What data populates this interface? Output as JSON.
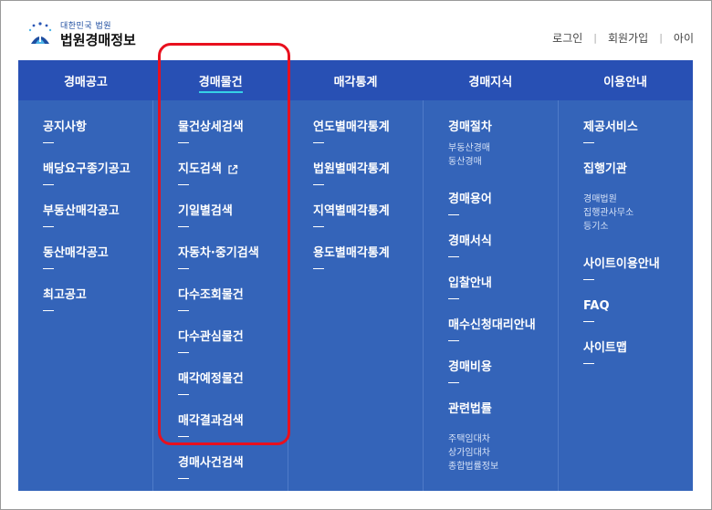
{
  "header": {
    "logo_small": "대한민국 법원",
    "logo_title": "법원경매정보",
    "util": [
      "로그인",
      "회원가입",
      "아이"
    ]
  },
  "nav": {
    "items": [
      "경매공고",
      "경매물건",
      "매각통계",
      "경매지식",
      "이용안내"
    ],
    "active_index": 1,
    "bg_color": "#2850b4",
    "active_underline_color": "#36d1e6"
  },
  "menu": {
    "col0": [
      "공지사항",
      "배당요구종기공고",
      "부동산매각공고",
      "동산매각공고",
      "최고공고"
    ],
    "col1": [
      "물건상세검색",
      "지도검색",
      "기일별검색",
      "자동차·중기검색",
      "다수조회물건",
      "다수관심물건",
      "매각예정물건",
      "매각결과검색",
      "경매사건검색"
    ],
    "col2": [
      "연도별매각통계",
      "법원별매각통계",
      "지역별매각통계",
      "용도별매각통계"
    ],
    "col3": {
      "procedure": "경매절차",
      "procedure_subs": [
        "부동산경매",
        "동산경매"
      ],
      "items": [
        "경매용어",
        "경매서식",
        "입찰안내",
        "매수신청대리안내",
        "경매비용",
        "관련법률"
      ],
      "law_subs": [
        "주택임대차",
        "상가임대차",
        "종합법률정보"
      ]
    },
    "col4": {
      "service": "제공서비스",
      "agency": "집행기관",
      "agency_subs": [
        "경매법원",
        "집행관사무소",
        "등기소"
      ],
      "items": [
        "사이트이용안내",
        "FAQ",
        "사이트맵"
      ]
    },
    "bg_color": "#3464b9",
    "external_link_icon": "external-link-icon"
  },
  "highlight_color": "#e8101e"
}
